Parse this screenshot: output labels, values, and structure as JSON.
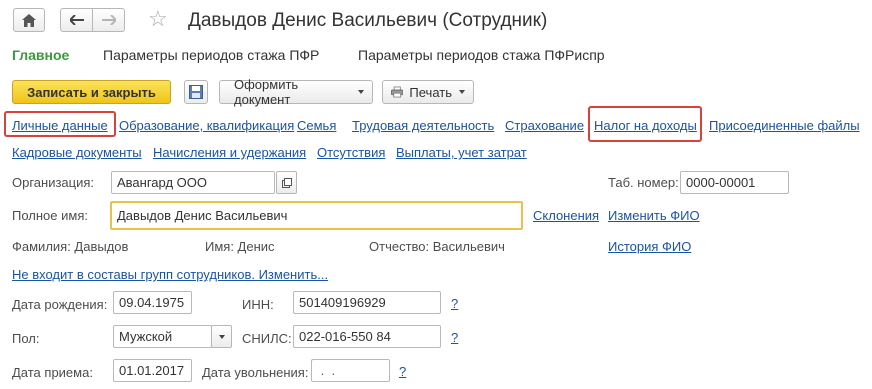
{
  "window": {
    "title": "Давыдов Денис Васильевич (Сотрудник)"
  },
  "nav_tabs": [
    "Главное",
    "Параметры периодов стажа ПФР",
    "Параметры периодов стажа ПФРиспр"
  ],
  "toolbar": {
    "save_close": "Записать и закрыть",
    "make_document": "Оформить документ",
    "print": "Печать"
  },
  "links_row1": [
    "Личные данные",
    "Образование, квалификация",
    "Семья",
    "Трудовая деятельность",
    "Страхование",
    "Налог на доходы",
    "Присоединенные файлы"
  ],
  "links_row2": [
    "Кадровые документы",
    "Начисления и удержания",
    "Отсутствия",
    "Выплаты, учет затрат"
  ],
  "form": {
    "org_label": "Организация:",
    "org_value": "Авангард ООО",
    "tab_label": "Таб. номер:",
    "tab_value": "0000-00001",
    "fullname_label": "Полное имя:",
    "fullname_value": "Давыдов Денис Васильевич",
    "declension_link": "Склонения",
    "change_fio_link": "Изменить ФИО",
    "surname_text": "Фамилия: Давыдов",
    "name_text": "Имя: Денис",
    "patronymic_text": "Отчество: Васильевич",
    "fio_history_link": "История ФИО",
    "groups_link": "Не входит в составы групп сотрудников. Изменить...",
    "birth_label": "Дата рождения:",
    "birth_value": "09.04.1975",
    "inn_label": "ИНН:",
    "inn_value": "501409196929",
    "help_mark": "?",
    "gender_label": "Пол:",
    "gender_value": "Мужской",
    "snils_label": "СНИЛС:",
    "snils_value": "022-016-550 84",
    "hire_label": "Дата приема:",
    "hire_value": "01.01.2017",
    "dismiss_label": "Дата увольнения:",
    "dismiss_value": " .  ."
  },
  "colors": {
    "link": "#1a54a6",
    "accent_green": "#3a9a3a",
    "primary_button": "#f5d130",
    "highlight_red": "#d9413b",
    "focus_border": "#e8c34a"
  }
}
